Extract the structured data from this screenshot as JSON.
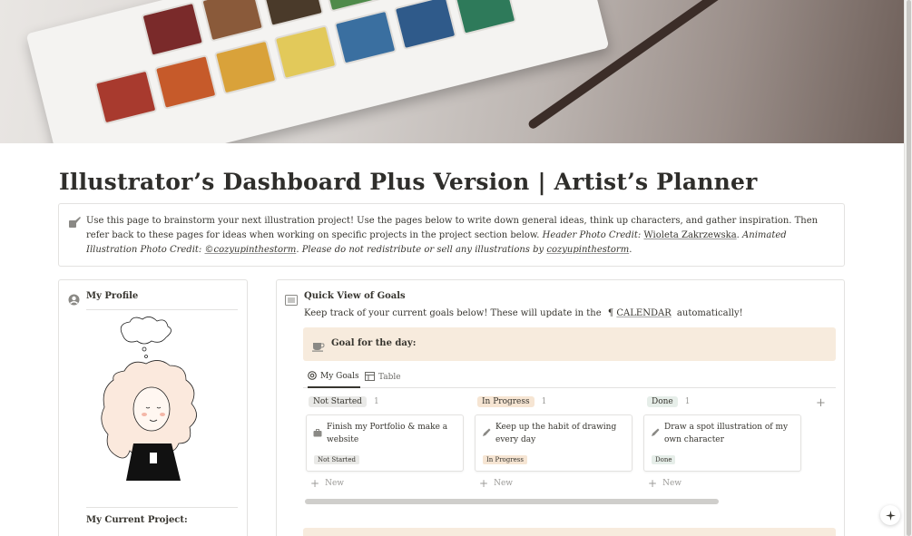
{
  "page": {
    "title": "Illustrator’s Dashboard Plus Version | Artist’s Planner"
  },
  "callout": {
    "icon": "paintbrush-icon",
    "text_main": "Use this page to brainstorm your next illustration project! Use the pages below to write down general ideas, think up characters, and gather inspiration. Then refer back to these pages for ideas when working on specific projects in the project section below.",
    "header_credit_label": "Header Photo Credit:",
    "header_credit_name": "Wioleta Zakrzewska",
    "animated_credit_label": "Animated Illustration Photo Credit:",
    "animated_credit_name": "©cozyupinthestorm",
    "notice": "Please do not redistribute or sell any illustrations by",
    "notice_name": "cozyupinthestorm",
    "period": "."
  },
  "profile": {
    "icon": "user-circle-icon",
    "heading": "My Profile",
    "current_project": "My Current Project:"
  },
  "goals": {
    "icon": "dashboard-icon",
    "heading": "Quick View of Goals",
    "sub_before": "Keep track of your current goals below! These will update in the",
    "calendar_icon": "calendar-icon",
    "calendar_link": "CALENDAR",
    "sub_after": "automatically!",
    "goal_box_icon": "coffee-cup-icon",
    "goal_box_label": "Goal for the day:",
    "tabs": [
      {
        "label": "My Goals",
        "icon": "target-icon"
      },
      {
        "label": "Table",
        "icon": "table-icon"
      }
    ],
    "columns": [
      {
        "status": "Not Started",
        "count": "1",
        "color": "#e9e9e7",
        "card": {
          "title": "Finish my Portfolio & make a website",
          "tag": "Not Started",
          "icon": "briefcase-icon"
        }
      },
      {
        "status": "In Progress",
        "count": "1",
        "color": "#f6e5d3",
        "card": {
          "title": "Keep up the habit of drawing every day",
          "tag": "In Progress",
          "icon": "pencil-icon"
        }
      },
      {
        "status": "Done",
        "count": "1",
        "color": "#e6eee9",
        "card": {
          "title": "Draw a spot illustration of my own character",
          "tag": "Done",
          "icon": "pencil-icon"
        }
      }
    ],
    "new_label": "New"
  }
}
